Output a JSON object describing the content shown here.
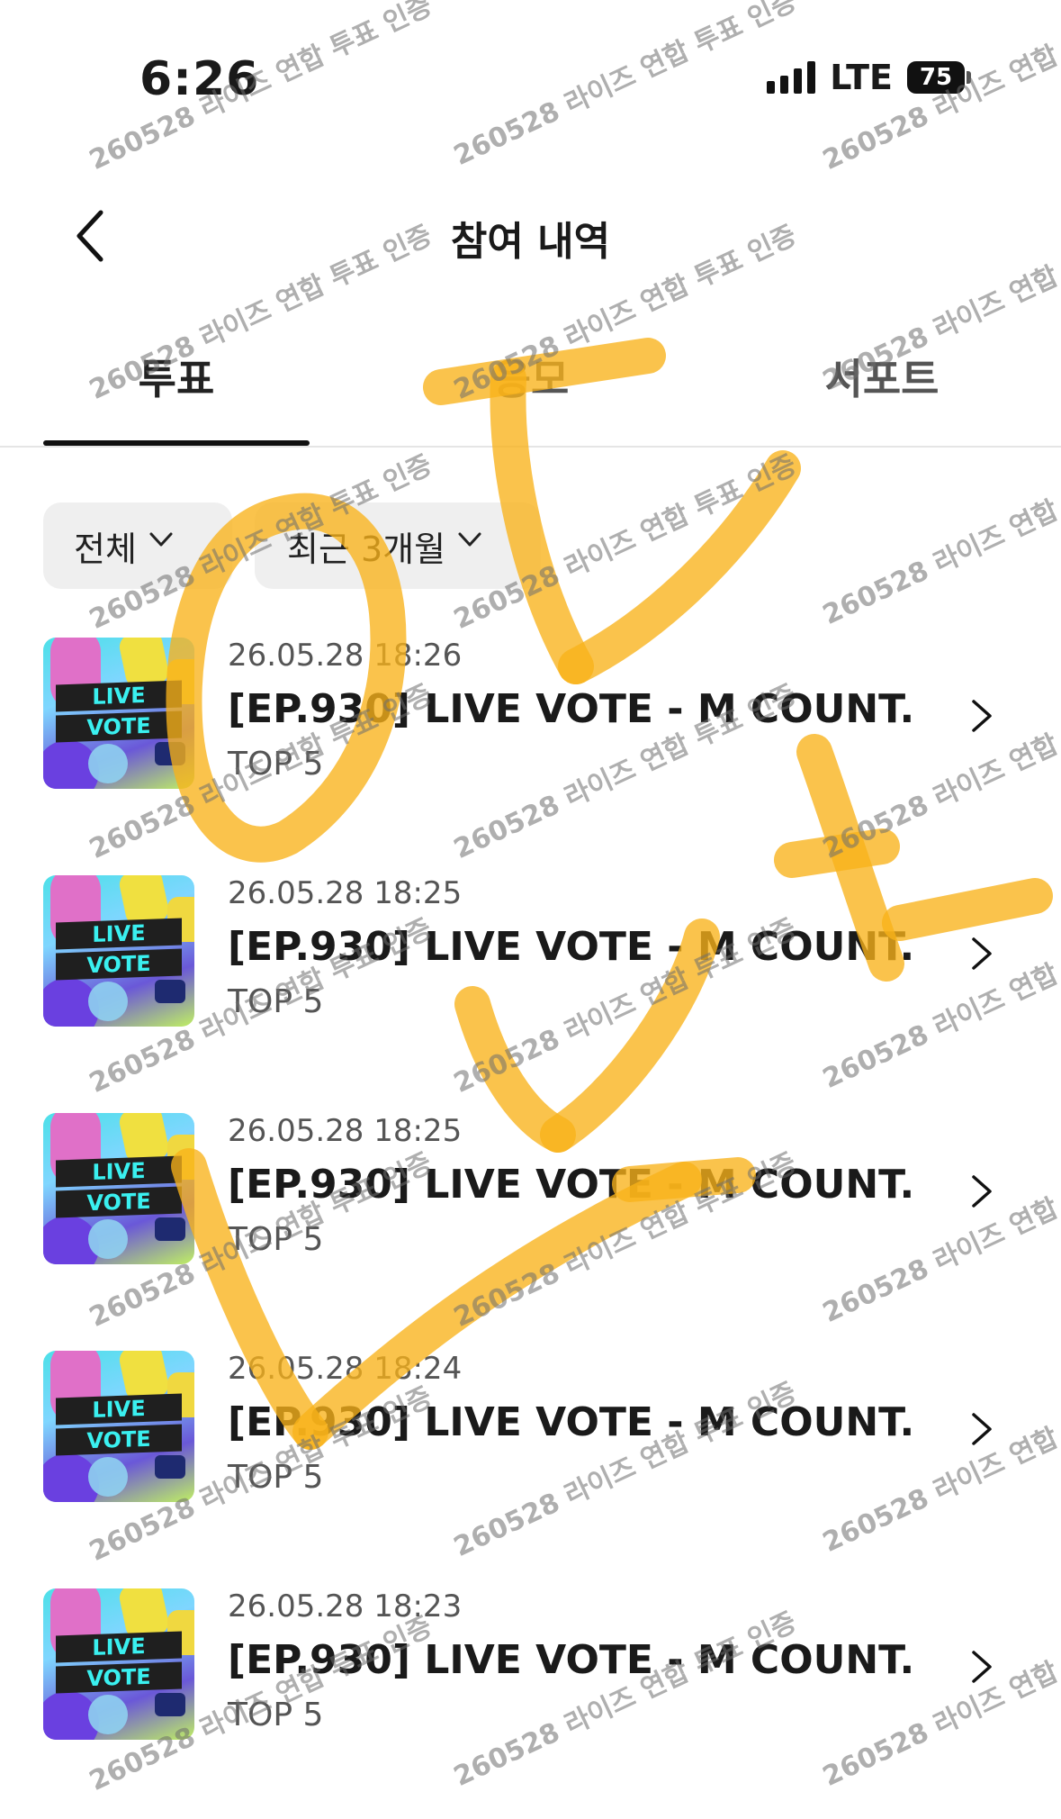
{
  "status_bar": {
    "time": "6:26",
    "network": "LTE",
    "battery": "75",
    "signal_bars": 4
  },
  "header": {
    "title": "참여 내역",
    "back_icon": "chevron-left-icon"
  },
  "tabs": [
    {
      "label": "투표",
      "active": true
    },
    {
      "label": "응모",
      "active": false
    },
    {
      "label": "서포트",
      "active": false
    }
  ],
  "filters": {
    "type": "전체",
    "period": "최근 3개월"
  },
  "items": [
    {
      "date": "26.05.28 18:26",
      "title": "[EP.930] LIVE VOTE - M COUNT...",
      "sub": "TOP 5"
    },
    {
      "date": "26.05.28 18:25",
      "title": "[EP.930] LIVE VOTE - M COUNT...",
      "sub": "TOP 5"
    },
    {
      "date": "26.05.28 18:25",
      "title": "[EP.930] LIVE VOTE - M COUNT...",
      "sub": "TOP 5"
    },
    {
      "date": "26.05.28 18:24",
      "title": "[EP.930] LIVE VOTE - M COUNT...",
      "sub": "TOP 5"
    },
    {
      "date": "26.05.28 18:23",
      "title": "[EP.930] LIVE VOTE - M COUNT...",
      "sub": "TOP 5"
    }
  ],
  "thumbnail": {
    "line1": "LIVE",
    "line2": "VOTE"
  },
  "watermark": "260528 라이즈 연합 투표 인증",
  "colors": {
    "accent": "#111111",
    "highlighter": "#f8b21a",
    "filter_bg": "#efefef"
  }
}
